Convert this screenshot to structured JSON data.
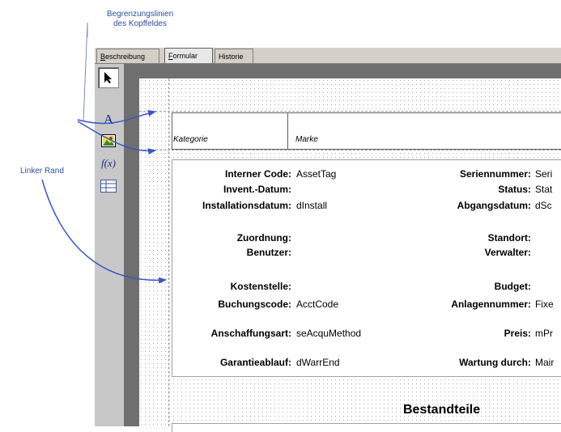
{
  "callouts": {
    "header_lines_line1": "Begrenzungslinien",
    "header_lines_line2": "des Kopffeldes",
    "left_margin": "Linker Rand"
  },
  "tabs": [
    {
      "label_u": "B",
      "label_rest": "eschreibung",
      "active": false
    },
    {
      "label_u": "F",
      "label_rest": "ormular",
      "active": true
    },
    {
      "label": "Historie",
      "active": false
    }
  ],
  "toolbar": {
    "tools": [
      "pointer-tool",
      "text-tool",
      "image-tool",
      "formula-tool",
      "table-tool"
    ],
    "text_glyph": "A",
    "formula_glyph": "f(x)"
  },
  "header": {
    "category_label": "Kategorie",
    "brand_label": "Marke"
  },
  "fields_left": [
    {
      "label": "Interner Code:",
      "value": "AssetTag"
    },
    {
      "label": "Invent.-Datum:",
      "value": ""
    },
    {
      "label": "Installationsdatum:",
      "value": "dInstall"
    },
    {
      "label": "Zuordnung:",
      "value": ""
    },
    {
      "label": "Benutzer:",
      "value": ""
    },
    {
      "label": "Kostenstelle:",
      "value": ""
    },
    {
      "label": "Buchungscode:",
      "value": "AcctCode"
    },
    {
      "label": "Anschaffungsart:",
      "value": "seAcquMethod"
    },
    {
      "label": "Garantieablauf:",
      "value": "dWarrEnd"
    }
  ],
  "fields_right": [
    {
      "label": "Seriennummer:",
      "value": "Seri"
    },
    {
      "label": "Status:",
      "value": "Stat"
    },
    {
      "label": "Abgangsdatum:",
      "value": "dSc"
    },
    {
      "label": "Standort:",
      "value": ""
    },
    {
      "label": "Verwalter:",
      "value": ""
    },
    {
      "label": "Budget:",
      "value": ""
    },
    {
      "label": "Anlagennummer:",
      "value": "Fixe"
    },
    {
      "label": "Preis:",
      "value": "mPr"
    },
    {
      "label": "Wartung durch:",
      "value": "Mair"
    }
  ],
  "section_title": "Bestandteile",
  "colors": {
    "callout": "#2a4f9c",
    "arrow": "#3a55c8",
    "window": "#d4d0c8",
    "canvas_bg": "#6f6f6f"
  }
}
